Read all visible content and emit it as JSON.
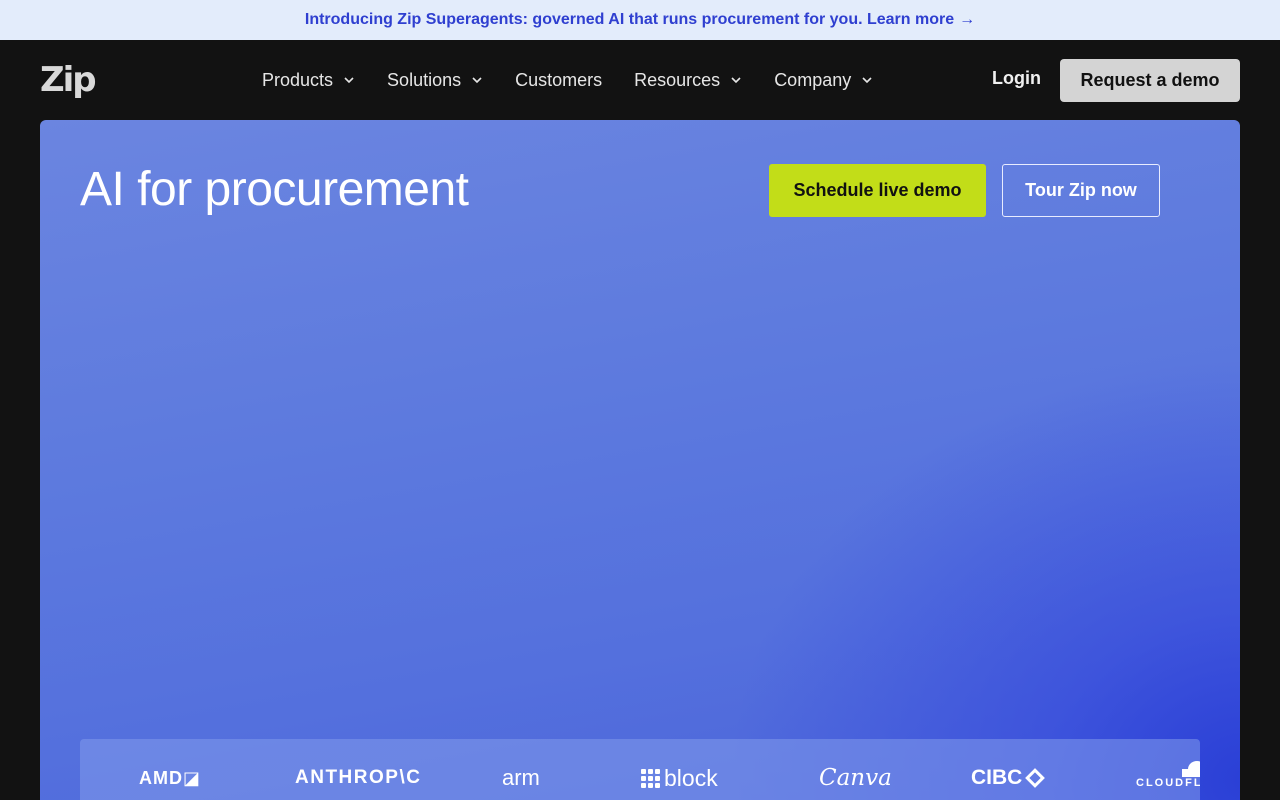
{
  "announcement": {
    "text": "Introducing Zip Superagents: governed AI that runs procurement for you. Learn more",
    "arrow": "→"
  },
  "nav": {
    "logo": "Zip",
    "items": [
      {
        "label": "Products",
        "dropdown": true
      },
      {
        "label": "Solutions",
        "dropdown": true
      },
      {
        "label": "Customers",
        "dropdown": false
      },
      {
        "label": "Resources",
        "dropdown": true
      },
      {
        "label": "Company",
        "dropdown": true
      }
    ],
    "login": "Login",
    "cta": "Request a demo"
  },
  "hero": {
    "title": "AI for procurement",
    "primary_button": "Schedule live demo",
    "secondary_button": "Tour Zip now"
  },
  "customer_logos": [
    {
      "name": "amd-logo",
      "text": "AMD◪"
    },
    {
      "name": "anthropic-logo",
      "text": "ANTHROP\\C"
    },
    {
      "name": "arm-logo",
      "text": "arm"
    },
    {
      "name": "block-logo",
      "text": "block"
    },
    {
      "name": "canva-logo",
      "text": "Canva"
    },
    {
      "name": "cibc-logo",
      "text": "CIBC"
    },
    {
      "name": "cloudflare-logo",
      "text": "CLOUDFL"
    }
  ],
  "colors": {
    "announce_bg": "#e3ecfb",
    "announce_text": "#2f3fd0",
    "nav_bg": "#121212",
    "hero_blue": "#5d7ade",
    "primary_button": "#c2dd18",
    "request_demo_bg": "#d4d4d4"
  }
}
